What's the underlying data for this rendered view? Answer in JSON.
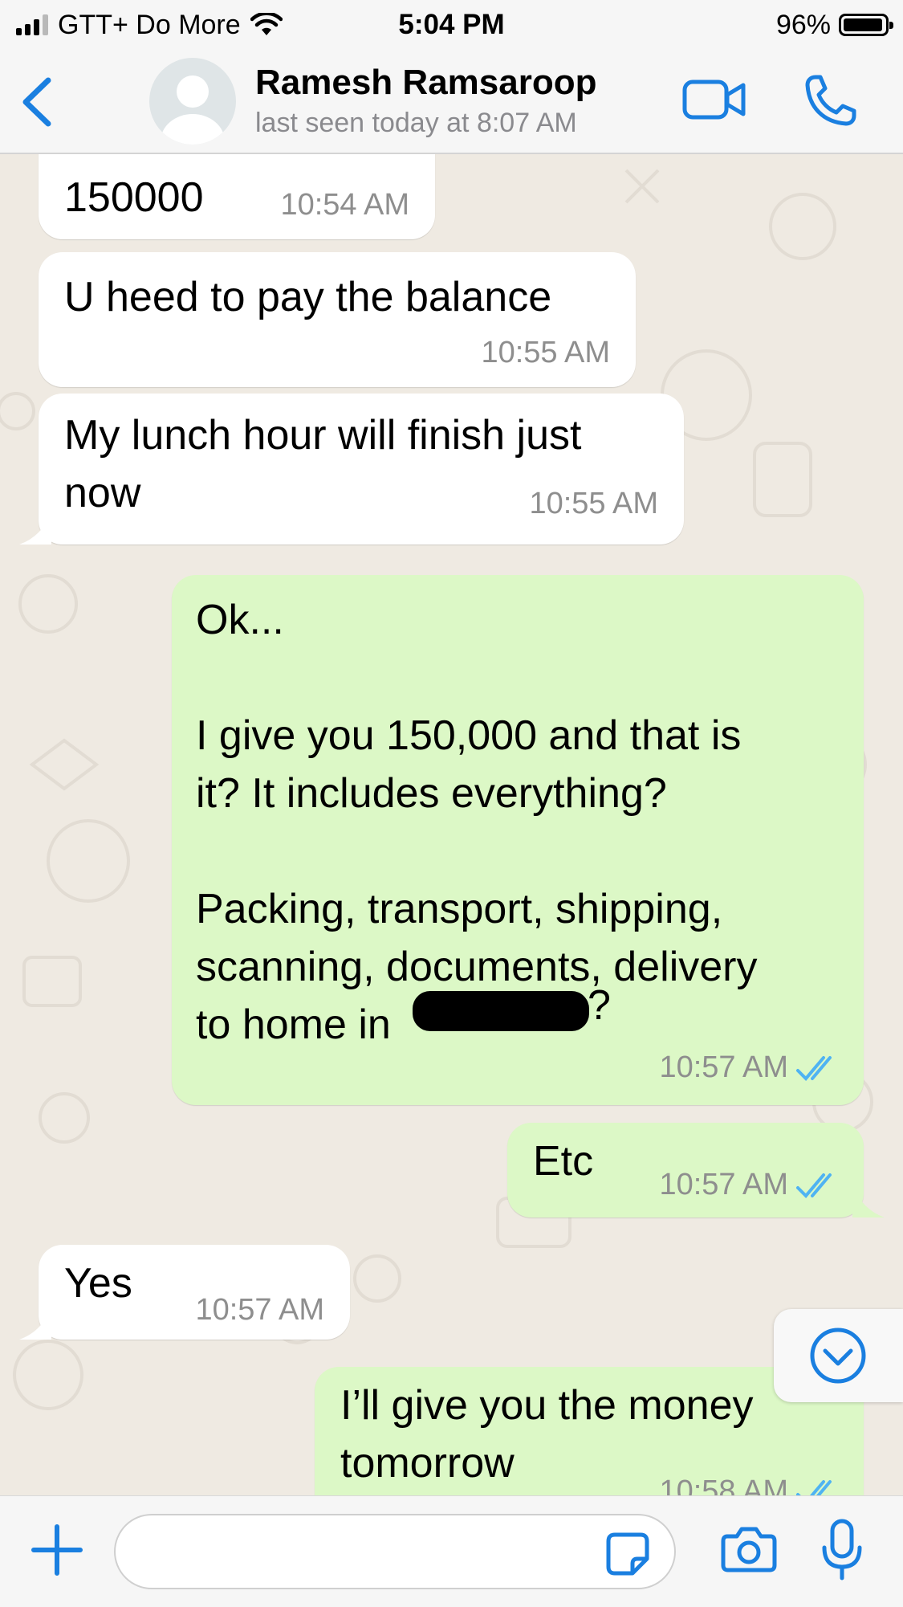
{
  "status_bar": {
    "carrier": "GTT+ Do More",
    "time": "5:04 PM",
    "battery": "96%",
    "battery_level": 0.96
  },
  "header": {
    "contact_name": "Ramesh Ramsaroop",
    "last_seen": "last seen today at 8:07 AM"
  },
  "messages": [
    {
      "direction": "incoming",
      "text": "150000",
      "time": "10:54 AM"
    },
    {
      "direction": "incoming",
      "text": "U heed to pay the balance",
      "time": "10:55 AM"
    },
    {
      "direction": "incoming",
      "text": "My lunch hour will finish just\nnow",
      "time": "10:55 AM"
    },
    {
      "direction": "outgoing",
      "text": "Ok...\n\nI give you 150,000 and that is\nit? It includes everything?\n\nPacking, transport, shipping,\nscanning, documents, delivery\nto home in",
      "text_after_redaction": "?",
      "time": "10:57 AM",
      "status": "read"
    },
    {
      "direction": "outgoing",
      "text": "Etc",
      "time": "10:57 AM",
      "status": "read"
    },
    {
      "direction": "incoming",
      "text": "Yes",
      "time": "10:57 AM"
    },
    {
      "direction": "outgoing",
      "text": "I’ll give you the money\ntomorrow",
      "time": "10:58 AM",
      "status": "read"
    }
  ],
  "colors": {
    "accent": "#1a7fe0",
    "incoming_bubble": "#ffffff",
    "outgoing_bubble": "#dcf8c6",
    "chat_background": "#efeae2",
    "read_ticks": "#4fb3f2"
  },
  "icons": [
    "back-chevron-icon",
    "avatar-placeholder-icon",
    "video-call-icon",
    "phone-icon",
    "scroll-down-icon",
    "plus-icon",
    "sticker-icon",
    "camera-icon",
    "microphone-icon",
    "read-ticks-icon"
  ]
}
